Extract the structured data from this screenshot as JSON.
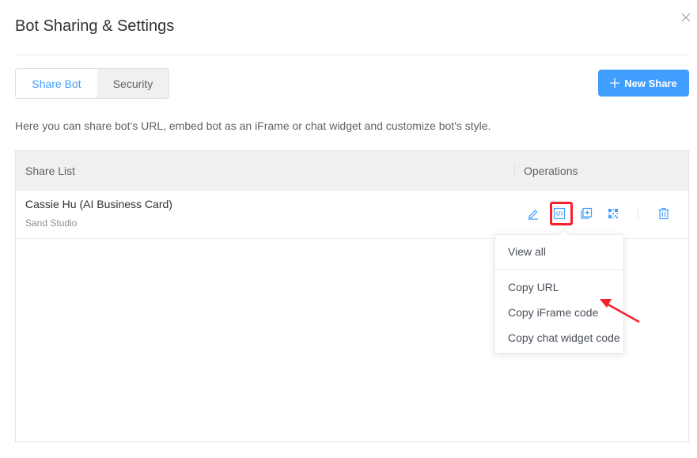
{
  "dialog": {
    "title": "Bot Sharing & Settings",
    "close_icon": "close-icon"
  },
  "tabs": [
    {
      "label": "Share Bot",
      "active": true
    },
    {
      "label": "Security",
      "active": false
    }
  ],
  "toolbar": {
    "new_share_icon": "plus-icon",
    "new_share_label": "New Share"
  },
  "description": "Here you can share bot's URL, embed bot as an iFrame or chat widget and customize bot's style.",
  "table": {
    "columns": [
      "Share List",
      "Operations"
    ],
    "rows": [
      {
        "title": "Cassie Hu (AI Business Card)",
        "subtitle": "Sand Studio",
        "operations": [
          "edit-icon",
          "embed-code-icon",
          "duplicate-icon",
          "qr-code-icon",
          "delete-icon"
        ]
      }
    ]
  },
  "popover": {
    "items": [
      "View all",
      "Copy URL",
      "Copy iFrame code",
      "Copy chat widget code"
    ]
  },
  "colors": {
    "accent": "#409eff",
    "annotation": "#f5222d"
  }
}
